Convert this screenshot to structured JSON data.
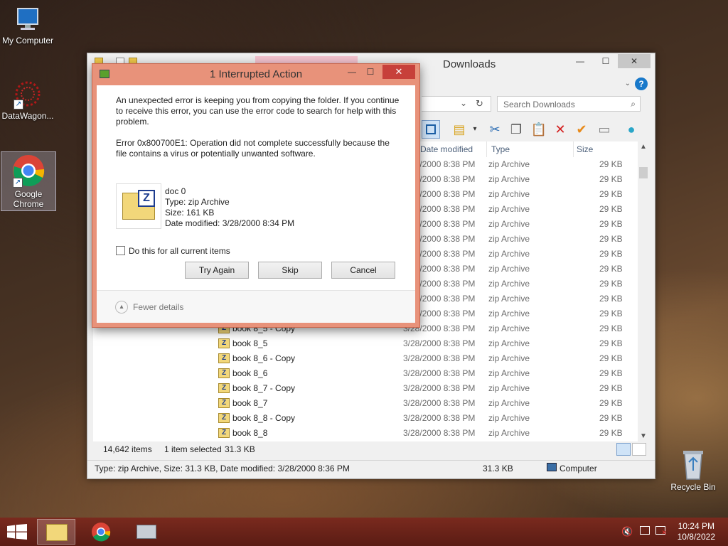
{
  "desktop": {
    "icons": [
      {
        "label": "My Computer"
      },
      {
        "label": "DataWagon..."
      },
      {
        "label": "Google Chrome"
      },
      {
        "label": "Recycle Bin"
      }
    ]
  },
  "explorer": {
    "title": "Downloads",
    "search_placeholder": "Search Downloads",
    "columns": {
      "date": "Date modified",
      "type": "Type",
      "size": "Size"
    },
    "rows": [
      {
        "name": "",
        "date": "3/28/2000 8:38 PM",
        "type": "zip Archive",
        "size": "29 KB"
      },
      {
        "name": "",
        "date": "3/28/2000 8:38 PM",
        "type": "zip Archive",
        "size": "29 KB"
      },
      {
        "name": "",
        "date": "3/28/2000 8:38 PM",
        "type": "zip Archive",
        "size": "29 KB"
      },
      {
        "name": "",
        "date": "3/28/2000 8:38 PM",
        "type": "zip Archive",
        "size": "29 KB"
      },
      {
        "name": "",
        "date": "3/28/2000 8:38 PM",
        "type": "zip Archive",
        "size": "29 KB"
      },
      {
        "name": "",
        "date": "3/28/2000 8:38 PM",
        "type": "zip Archive",
        "size": "29 KB"
      },
      {
        "name": "",
        "date": "3/28/2000 8:38 PM",
        "type": "zip Archive",
        "size": "29 KB"
      },
      {
        "name": "",
        "date": "3/28/2000 8:38 PM",
        "type": "zip Archive",
        "size": "29 KB"
      },
      {
        "name": "",
        "date": "3/28/2000 8:38 PM",
        "type": "zip Archive",
        "size": "29 KB"
      },
      {
        "name": "",
        "date": "3/28/2000 8:38 PM",
        "type": "zip Archive",
        "size": "29 KB"
      },
      {
        "name": "",
        "date": "3/28/2000 8:38 PM",
        "type": "zip Archive",
        "size": "29 KB"
      },
      {
        "name": "book 8_5 - Copy",
        "date": "3/28/2000 8:38 PM",
        "type": "zip Archive",
        "size": "29 KB"
      },
      {
        "name": "book 8_5",
        "date": "3/28/2000 8:38 PM",
        "type": "zip Archive",
        "size": "29 KB"
      },
      {
        "name": "book 8_6 - Copy",
        "date": "3/28/2000 8:38 PM",
        "type": "zip Archive",
        "size": "29 KB"
      },
      {
        "name": "book 8_6",
        "date": "3/28/2000 8:38 PM",
        "type": "zip Archive",
        "size": "29 KB"
      },
      {
        "name": "book 8_7 - Copy",
        "date": "3/28/2000 8:38 PM",
        "type": "zip Archive",
        "size": "29 KB"
      },
      {
        "name": "book 8_7",
        "date": "3/28/2000 8:38 PM",
        "type": "zip Archive",
        "size": "29 KB"
      },
      {
        "name": "book 8_8 - Copy",
        "date": "3/28/2000 8:38 PM",
        "type": "zip Archive",
        "size": "29 KB"
      },
      {
        "name": "book 8_8",
        "date": "3/28/2000 8:38 PM",
        "type": "zip Archive",
        "size": "29 KB"
      }
    ],
    "status": {
      "item_count": "14,642 items",
      "selected": "1 item selected",
      "selected_size": "31.3 KB",
      "details": "Type: zip Archive, Size: 31.3 KB, Date modified: 3/28/2000 8:36 PM",
      "size": "31.3 KB",
      "location": "Computer"
    }
  },
  "dialog": {
    "title": "1 Interrupted Action",
    "message": "An unexpected error is keeping you from copying the folder. If you continue to receive this error, you can use the error code to search for help with this problem.",
    "error": "Error 0x800700E1: Operation did not complete successfully because the file contains a virus or potentially unwanted software.",
    "file": {
      "name": "doc 0",
      "type": "Type: zip Archive",
      "size": "Size: 161 KB",
      "date": "Date modified: 3/28/2000 8:34 PM"
    },
    "checkbox_label": "Do this for all current items",
    "buttons": {
      "try_again": "Try Again",
      "skip": "Skip",
      "cancel": "Cancel"
    },
    "fewer_details": "Fewer details"
  },
  "taskbar": {
    "time": "10:24 PM",
    "date": "10/8/2022"
  }
}
